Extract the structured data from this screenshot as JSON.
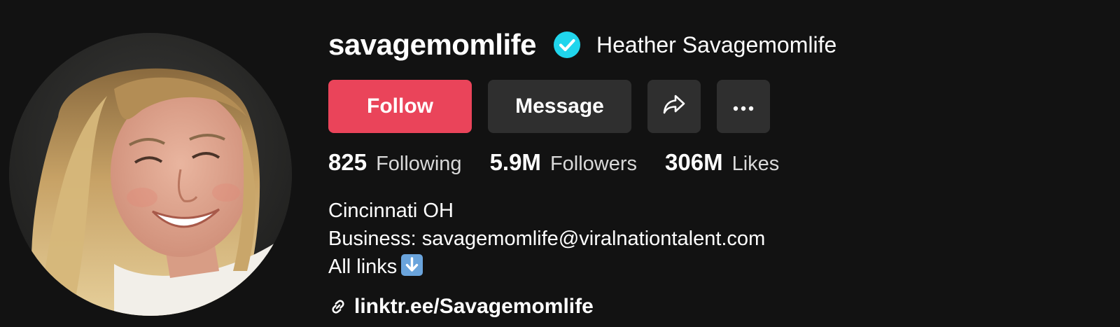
{
  "profile": {
    "username": "savagemomlife",
    "verified": true,
    "display_name": "Heather Savagemomlife",
    "avatar_icon": "profile-photo"
  },
  "actions": {
    "follow_label": "Follow",
    "message_label": "Message",
    "share_icon": "share-arrow-icon",
    "more_icon": "more-horizontal-icon"
  },
  "stats": [
    {
      "value": "825",
      "label": "Following"
    },
    {
      "value": "5.9M",
      "label": "Followers"
    },
    {
      "value": "306M",
      "label": "Likes"
    }
  ],
  "bio": {
    "line1": "Cincinnati OH",
    "line2": "Business: savagemomlife@viralnationtalent.com",
    "line3": "All links",
    "line3_emoji": "down-arrow-emoji"
  },
  "link": {
    "icon": "link-icon",
    "text": "linktr.ee/Savagemomlife"
  },
  "colors": {
    "background": "#121212",
    "follow": "#ea445a",
    "secondary_button": "#2f2f2f",
    "verified": "#20d5ec"
  }
}
